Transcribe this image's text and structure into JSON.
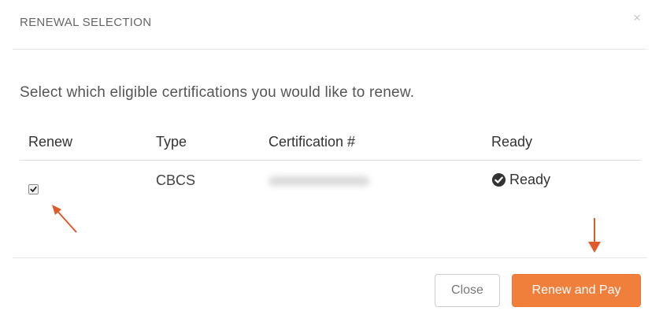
{
  "modal": {
    "title": "RENEWAL SELECTION",
    "close_glyph": "×",
    "instructions": "Select which eligible certifications you would like to renew."
  },
  "table": {
    "headers": {
      "renew": "Renew",
      "type": "Type",
      "certification": "Certification #",
      "ready": "Ready"
    },
    "rows": [
      {
        "renew_checked": true,
        "type": "CBCS",
        "certification": "",
        "certification_redacted": true,
        "ready_icon": "check-circle-icon",
        "ready": "Ready"
      }
    ]
  },
  "footer": {
    "close_label": "Close",
    "renew_label": "Renew and Pay"
  },
  "annotations": {
    "arrow_color": "#e05a2b",
    "items": [
      "arrow-to-checkbox",
      "arrow-to-renew-button"
    ]
  },
  "colors": {
    "accent": "#f07f3c",
    "divider": "#e6e6e6",
    "text": "#333333"
  }
}
